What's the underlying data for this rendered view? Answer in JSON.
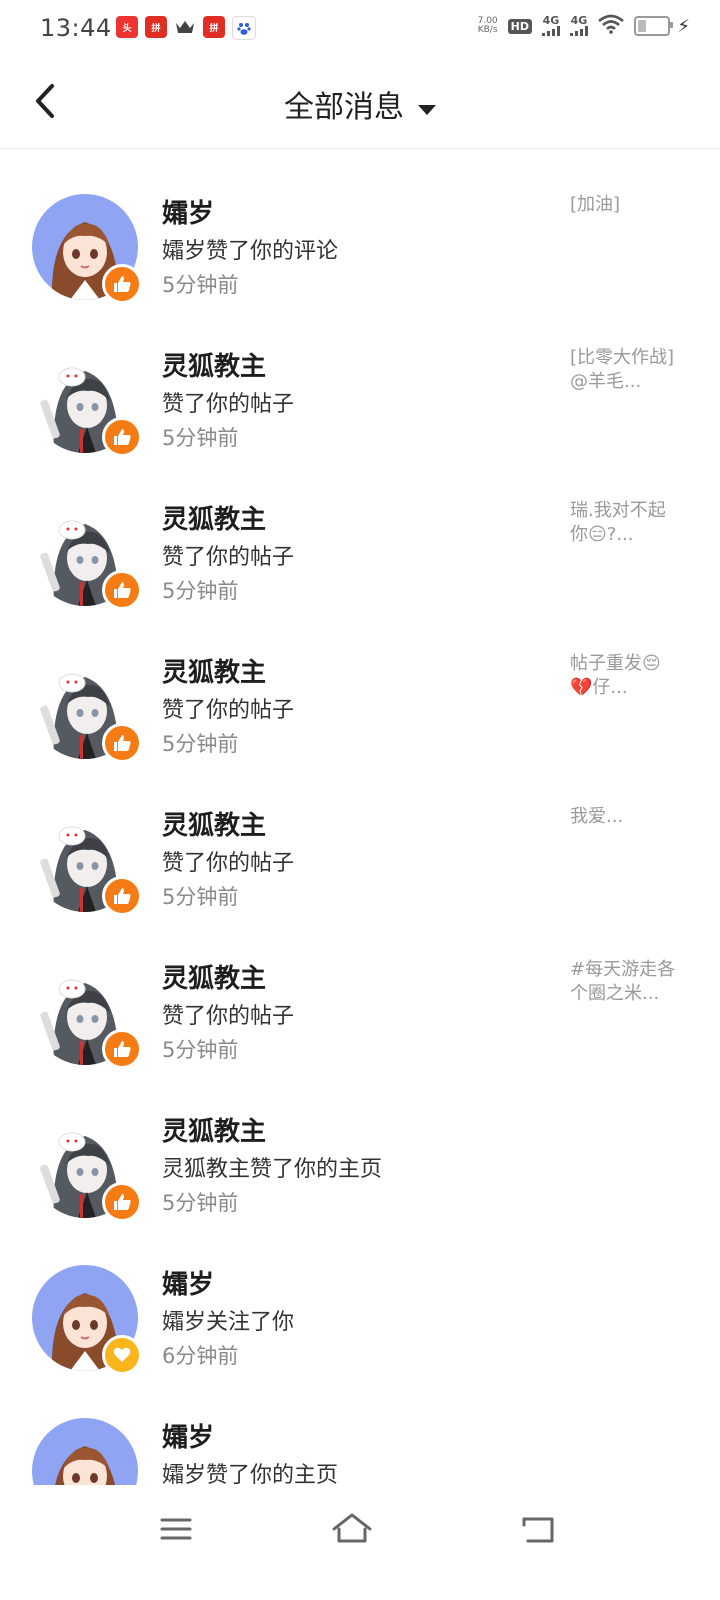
{
  "status_bar": {
    "time": "13:44",
    "net_speed_value": "7.00",
    "net_speed_unit": "KB/s",
    "hd_label": "HD",
    "network_1": "4G",
    "network_2": "4G",
    "app_icons": [
      "toutiao-icon",
      "pinduoduo-icon",
      "crown-icon",
      "pinduoduo-icon",
      "baidu-icon"
    ]
  },
  "header": {
    "title": "全部消息"
  },
  "messages": [
    {
      "name": "孀岁",
      "action": "孀岁赞了你的评论",
      "time": "5分钟前",
      "preview": "[加油]",
      "avatar": "brown-hair-girl",
      "badge": "thumbs-up-icon"
    },
    {
      "name": "灵狐教主",
      "action": "赞了你的帖子",
      "time": "5分钟前",
      "preview": "[比零大作战]@羊毛...",
      "avatar": "fox-mask-girl",
      "badge": "thumbs-up-icon"
    },
    {
      "name": "灵狐教主",
      "action": "赞了你的帖子",
      "time": "5分钟前",
      "preview": "瑞.我对不起你😑?...",
      "avatar": "fox-mask-girl",
      "badge": "thumbs-up-icon"
    },
    {
      "name": "灵狐教主",
      "action": "赞了你的帖子",
      "time": "5分钟前",
      "preview": "帖子重发😔💔仔...",
      "avatar": "fox-mask-girl",
      "badge": "thumbs-up-icon"
    },
    {
      "name": "灵狐教主",
      "action": "赞了你的帖子",
      "time": "5分钟前",
      "preview": "我爱...",
      "avatar": "fox-mask-girl",
      "badge": "thumbs-up-icon"
    },
    {
      "name": "灵狐教主",
      "action": "赞了你的帖子",
      "time": "5分钟前",
      "preview": "#每天游走各个圈之米...",
      "avatar": "fox-mask-girl",
      "badge": "thumbs-up-icon"
    },
    {
      "name": "灵狐教主",
      "action": "灵狐教主赞了你的主页",
      "time": "5分钟前",
      "preview": "",
      "avatar": "fox-mask-girl",
      "badge": "thumbs-up-icon"
    },
    {
      "name": "孀岁",
      "action": "孀岁关注了你",
      "time": "6分钟前",
      "preview": "",
      "avatar": "brown-hair-girl",
      "badge": "heart-icon"
    },
    {
      "name": "孀岁",
      "action": "孀岁赞了你的主页",
      "time": "",
      "preview": "",
      "avatar": "brown-hair-girl",
      "badge": "thumbs-up-icon"
    }
  ],
  "nav_bar": {
    "buttons": [
      "menu-icon",
      "home-icon",
      "back-icon"
    ]
  },
  "colors": {
    "like_badge": "#f57c14",
    "follow_badge": "#f8b61c",
    "avatar_bg_blue": "#8fa5f3"
  }
}
